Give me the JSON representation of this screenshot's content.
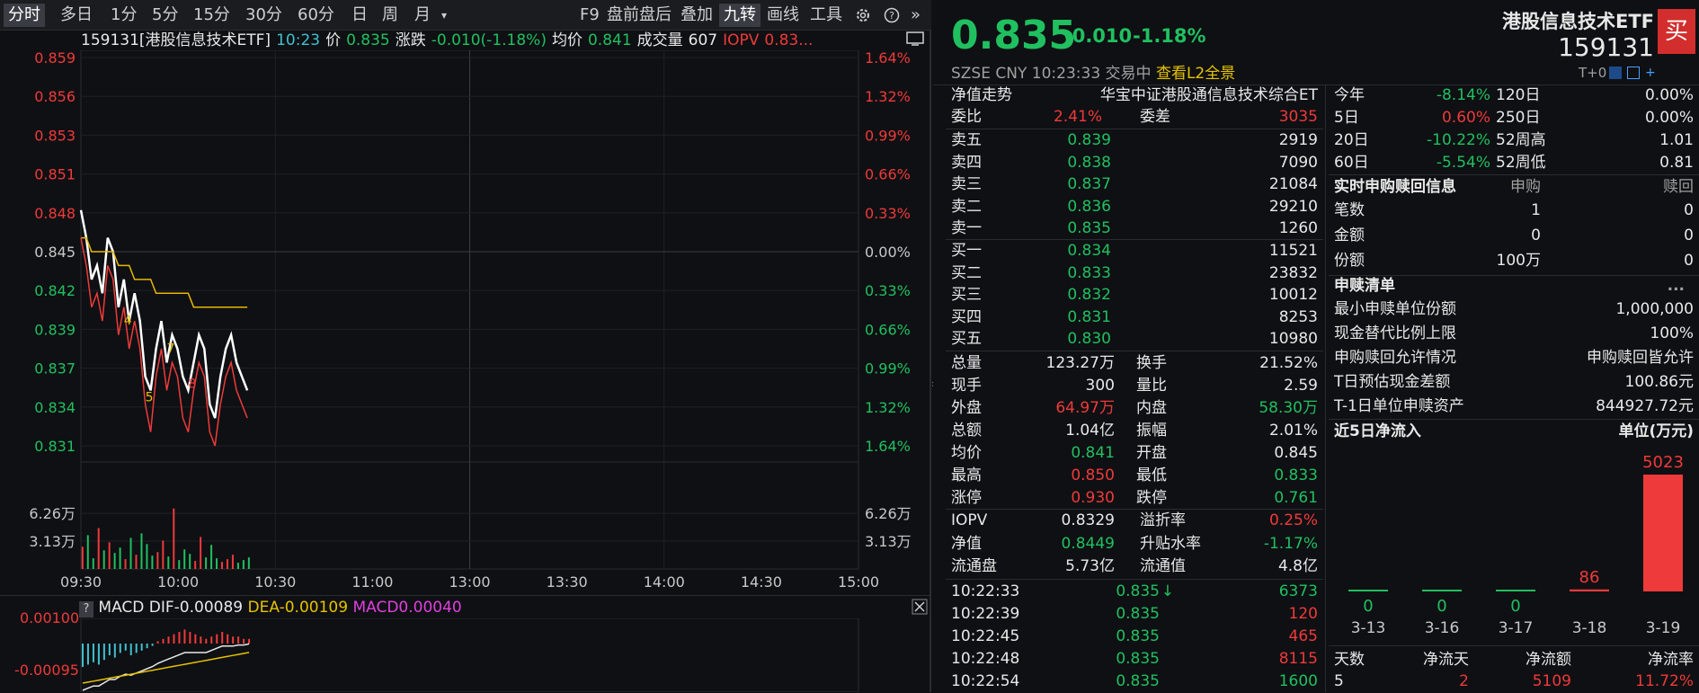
{
  "toolbar": {
    "left_tabs": [
      "分时",
      "多日",
      "1分",
      "5分",
      "15分",
      "30分",
      "60分",
      "日",
      "周",
      "月"
    ],
    "month_caret": "▾",
    "right_tabs": [
      "F9",
      "盘前盘后",
      "叠加",
      "九转",
      "画线",
      "工具"
    ],
    "expand_symbol": "»"
  },
  "info": {
    "code_name": "159131[港股信息技术ETF]",
    "time": "10:23",
    "price_label": "价",
    "price": "0.835",
    "change_label": "涨跌",
    "change": "-0.010(-1.18%)",
    "avg_label": "均价",
    "avg": "0.841",
    "vol_label": "成交量",
    "vol": "607",
    "iopv_label": "IOPV",
    "iopv": "0.83..."
  },
  "chart_data": {
    "type": "line",
    "x_ticks": [
      "09:30",
      "10:00",
      "10:30",
      "11:00",
      "13:00",
      "13:30",
      "14:00",
      "14:30",
      "15:00"
    ],
    "y_price_ticks": [
      "0.859",
      "0.856",
      "0.853",
      "0.851",
      "0.848",
      "0.845",
      "0.842",
      "0.839",
      "0.837",
      "0.834",
      "0.831"
    ],
    "y_pct_ticks": [
      "1.64%",
      "1.32%",
      "0.99%",
      "0.66%",
      "0.33%",
      "0.00%",
      "0.33%",
      "0.66%",
      "0.99%",
      "1.32%",
      "1.64%"
    ],
    "vol_ticks": [
      "6.26万",
      "3.13万"
    ],
    "ylim": [
      0.831,
      0.859
    ],
    "series": [
      {
        "name": "价",
        "color": "#ffffff",
        "values": [
          0.848,
          0.846,
          0.843,
          0.844,
          0.842,
          0.846,
          0.845,
          0.841,
          0.843,
          0.84,
          0.842,
          0.84,
          0.836,
          0.835,
          0.838,
          0.84,
          0.837,
          0.839,
          0.838,
          0.836,
          0.835,
          0.837,
          0.839,
          0.838,
          0.834,
          0.833,
          0.836,
          0.838,
          0.839,
          0.837,
          0.836,
          0.835
        ]
      },
      {
        "name": "均价",
        "color": "#e6b800",
        "values": [
          0.846,
          0.846,
          0.845,
          0.845,
          0.845,
          0.845,
          0.845,
          0.844,
          0.844,
          0.844,
          0.843,
          0.843,
          0.843,
          0.843,
          0.842,
          0.842,
          0.842,
          0.842,
          0.842,
          0.842,
          0.842,
          0.841,
          0.841,
          0.841,
          0.841,
          0.841,
          0.841,
          0.841,
          0.841,
          0.841,
          0.841,
          0.841
        ]
      },
      {
        "name": "IOPV",
        "color": "#ee3a3a",
        "values": [
          0.846,
          0.844,
          0.841,
          0.842,
          0.84,
          0.844,
          0.843,
          0.839,
          0.841,
          0.838,
          0.84,
          0.838,
          0.834,
          0.832,
          0.836,
          0.838,
          0.835,
          0.837,
          0.836,
          0.833,
          0.832,
          0.835,
          0.837,
          0.836,
          0.832,
          0.831,
          0.834,
          0.836,
          0.837,
          0.835,
          0.834,
          0.833
        ]
      }
    ],
    "volume": [
      2.5,
      3.8,
      1.2,
      4.6,
      2.1,
      3.0,
      1.8,
      2.4,
      1.1,
      3.5,
      1.6,
      4.0,
      2.8,
      1.5,
      1.9,
      3.2,
      1.4,
      6.8,
      1.0,
      2.2,
      1.7,
      0.9,
      3.6,
      1.3,
      2.7,
      1.2,
      0.8,
      1.1,
      1.6,
      0.7,
      1.0,
      1.3
    ],
    "volume_ylim": [
      0,
      9.4
    ],
    "nine_turn_marks": [
      "4",
      "5",
      "7",
      "8"
    ]
  },
  "macd": {
    "help": "?",
    "label": "MACD",
    "dif_label": "DIF",
    "dif": "-0.00089",
    "dea_label": "DEA",
    "dea": "-0.00109",
    "macd_label": "MACD",
    "macd": "0.00040",
    "y_ticks": [
      "0.00100",
      "-0.00095"
    ],
    "bars": [
      -1.0,
      -0.9,
      -0.8,
      -0.9,
      -0.7,
      -0.5,
      -0.6,
      -0.4,
      -0.3,
      -0.5,
      -0.4,
      -0.3,
      -0.2,
      -0.1,
      0.1,
      0.2,
      0.3,
      0.4,
      0.5,
      0.6,
      0.5,
      0.4,
      0.3,
      0.2,
      0.3,
      0.4,
      0.5,
      0.4,
      0.3,
      0.3,
      0.2,
      0.2
    ]
  },
  "header": {
    "price": "0.835",
    "change": "-0.010",
    "change_pct": "-1.18%",
    "name": "港股信息技术ETF",
    "code": "159131",
    "buy_btn": "买",
    "exchange": "SZSE",
    "currency": "CNY",
    "time": "10:23:33",
    "status": "交易中",
    "l2_link": "查看L2全景",
    "t0": "T+0"
  },
  "nav": {
    "label": "净值走势",
    "value": "华宝中证港股通信息技术综合ET"
  },
  "commission": {
    "ratio_label": "委比",
    "ratio": "2.41%",
    "diff_label": "委差",
    "diff": "3035"
  },
  "asks": [
    {
      "label": "卖五",
      "price": "0.839",
      "vol": "2919"
    },
    {
      "label": "卖四",
      "price": "0.838",
      "vol": "7090"
    },
    {
      "label": "卖三",
      "price": "0.837",
      "vol": "21084"
    },
    {
      "label": "卖二",
      "price": "0.836",
      "vol": "29210"
    },
    {
      "label": "卖一",
      "price": "0.835",
      "vol": "1260"
    }
  ],
  "bids": [
    {
      "label": "买一",
      "price": "0.834",
      "vol": "11521"
    },
    {
      "label": "买二",
      "price": "0.833",
      "vol": "23832"
    },
    {
      "label": "买三",
      "price": "0.832",
      "vol": "10012"
    },
    {
      "label": "买四",
      "price": "0.831",
      "vol": "8253"
    },
    {
      "label": "买五",
      "price": "0.830",
      "vol": "10980"
    }
  ],
  "stats": [
    {
      "l1": "总量",
      "v1": "123.27万",
      "c1": "white",
      "l2": "换手",
      "v2": "21.52%",
      "c2": "white"
    },
    {
      "l1": "现手",
      "v1": "300",
      "c1": "white",
      "l2": "量比",
      "v2": "2.59",
      "c2": "white"
    },
    {
      "l1": "外盘",
      "v1": "64.97万",
      "c1": "red",
      "l2": "内盘",
      "v2": "58.30万",
      "c2": "green"
    },
    {
      "l1": "总额",
      "v1": "1.04亿",
      "c1": "white",
      "l2": "振幅",
      "v2": "2.01%",
      "c2": "white"
    },
    {
      "l1": "均价",
      "v1": "0.841",
      "c1": "green",
      "l2": "开盘",
      "v2": "0.845",
      "c2": "white"
    },
    {
      "l1": "最高",
      "v1": "0.850",
      "c1": "red",
      "l2": "最低",
      "v2": "0.833",
      "c2": "green"
    },
    {
      "l1": "涨停",
      "v1": "0.930",
      "c1": "red",
      "l2": "跌停",
      "v2": "0.761",
      "c2": "green"
    }
  ],
  "iopv_block": [
    {
      "l1": "IOPV",
      "v1": "0.8329",
      "c1": "white",
      "l2": "溢折率",
      "v2": "0.25%",
      "c2": "red"
    },
    {
      "l1": "净值",
      "v1": "0.8449",
      "c1": "green",
      "l2": "升贴水率",
      "v2": "-1.17%",
      "c2": "green"
    },
    {
      "l1": "流通盘",
      "v1": "5.73亿",
      "c1": "white",
      "l2": "流通值",
      "v2": "4.8亿",
      "c2": "white"
    }
  ],
  "ticks": [
    {
      "time": "10:22:33",
      "price": "0.835",
      "arrow": "↓",
      "vol": "6373",
      "vc": "green"
    },
    {
      "time": "10:22:39",
      "price": "0.835",
      "arrow": "",
      "vol": "120",
      "vc": "red"
    },
    {
      "time": "10:22:45",
      "price": "0.835",
      "arrow": "",
      "vol": "465",
      "vc": "red"
    },
    {
      "time": "10:22:48",
      "price": "0.835",
      "arrow": "",
      "vol": "8115",
      "vc": "red"
    },
    {
      "time": "10:22:54",
      "price": "0.835",
      "arrow": "",
      "vol": "1600",
      "vc": "green"
    }
  ],
  "perf": [
    {
      "l1": "今年",
      "v1": "-8.14%",
      "c1": "green",
      "l2": "120日",
      "v2": "0.00%"
    },
    {
      "l1": "5日",
      "v1": "0.60%",
      "c1": "red",
      "l2": "250日",
      "v2": "0.00%"
    },
    {
      "l1": "20日",
      "v1": "-10.22%",
      "c1": "green",
      "l2": "52周高",
      "v2": "1.01"
    },
    {
      "l1": "60日",
      "v1": "-5.54%",
      "c1": "green",
      "l2": "52周低",
      "v2": "0.81"
    }
  ],
  "subscription": {
    "title": "实时申购赎回信息",
    "col1": "申购",
    "col2": "赎回",
    "rows": [
      {
        "label": "笔数",
        "v1": "1",
        "v2": "0"
      },
      {
        "label": "金额",
        "v1": "0",
        "v2": "0"
      },
      {
        "label": "份额",
        "v1": "100万",
        "v2": "0"
      }
    ]
  },
  "list": {
    "title": "申赎清单",
    "more": "...",
    "rows": [
      {
        "label": "最小申赎单位份额",
        "value": "1,000,000"
      },
      {
        "label": "现金替代比例上限",
        "value": "100%"
      },
      {
        "label": "申购赎回允许情况",
        "value": "申购赎回皆允许"
      },
      {
        "label": "T日预估现金差额",
        "value": "100.86元"
      },
      {
        "label": "T-1日单位申赎资产",
        "value": "844927.72元"
      }
    ]
  },
  "inflow": {
    "title": "近5日净流入",
    "unit": "单位(万元)",
    "dates": [
      "3-13",
      "3-16",
      "3-17",
      "3-18",
      "3-19"
    ],
    "values": [
      0,
      0,
      0,
      86,
      5023
    ],
    "summary_headers": [
      "天数",
      "净流天",
      "净流额",
      "净流率"
    ],
    "summary_values": [
      "5",
      "2",
      "5109",
      "11.72%"
    ]
  }
}
